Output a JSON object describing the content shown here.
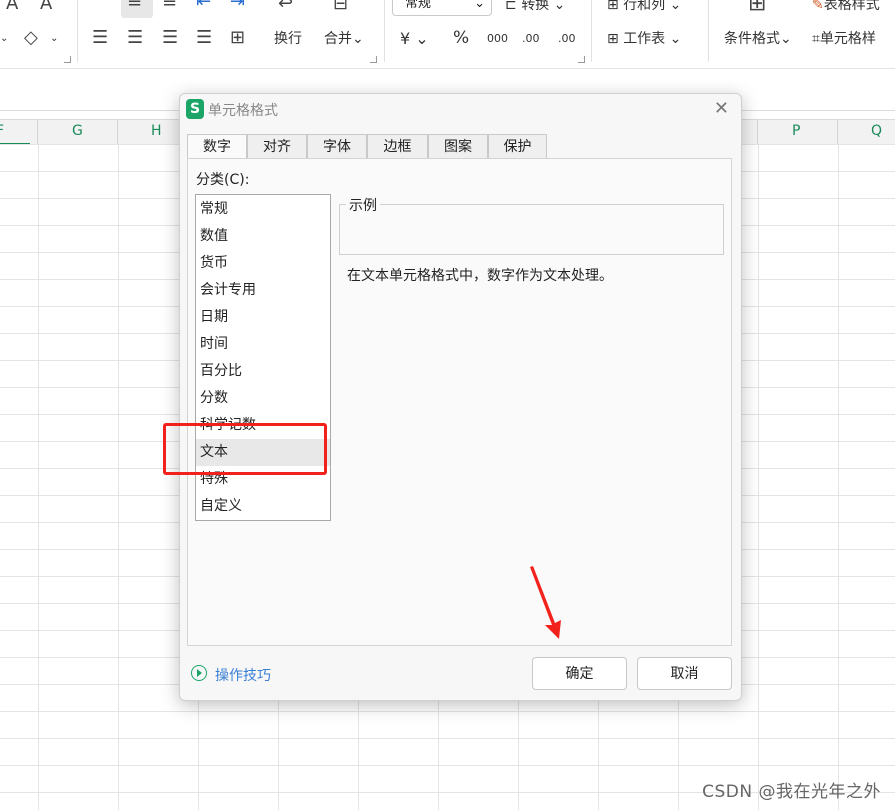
{
  "ribbon": {
    "font_grow": "A",
    "font_shrink": "A",
    "wrap_label": "换行",
    "merge_label": "合并",
    "number_format_value": "常规",
    "convert_label": "转换",
    "currency_symbol": "¥",
    "percent_symbol": "%",
    "thousands_symbol": "000",
    "dec_add_symbol": ".00",
    "dec_remove_symbol": ".00",
    "rows_cols_label": "行和列",
    "worksheet_label": "工作表",
    "conditional_format_label": "条件格式",
    "table_style_label": "表格样式",
    "cell_style_label": "单元格样"
  },
  "sheet": {
    "columns": [
      {
        "label": "F"
      },
      {
        "label": "G"
      },
      {
        "label": "H"
      },
      {
        "label": "P"
      },
      {
        "label": "Q"
      }
    ]
  },
  "dialog": {
    "logo": "S",
    "title": "单元格格式",
    "tabs": [
      {
        "label": "数字"
      },
      {
        "label": "对齐"
      },
      {
        "label": "字体"
      },
      {
        "label": "边框"
      },
      {
        "label": "图案"
      },
      {
        "label": "保护"
      }
    ],
    "active_tab": "数字",
    "category_label": "分类(C):",
    "categories": [
      "常规",
      "数值",
      "货币",
      "会计专用",
      "日期",
      "时间",
      "百分比",
      "分数",
      "科学记数",
      "文本",
      "特殊",
      "自定义"
    ],
    "selected_category": "文本",
    "sample_label": "示例",
    "description": "在文本单元格格式中，数字作为文本处理。",
    "tips_label": "操作技巧",
    "ok_label": "确定",
    "cancel_label": "取消"
  },
  "watermark": "CSDN @我在光年之外",
  "colors": {
    "accent_green": "#1ba566",
    "highlight_red": "#f2211b",
    "link_blue": "#3a7fd5"
  }
}
